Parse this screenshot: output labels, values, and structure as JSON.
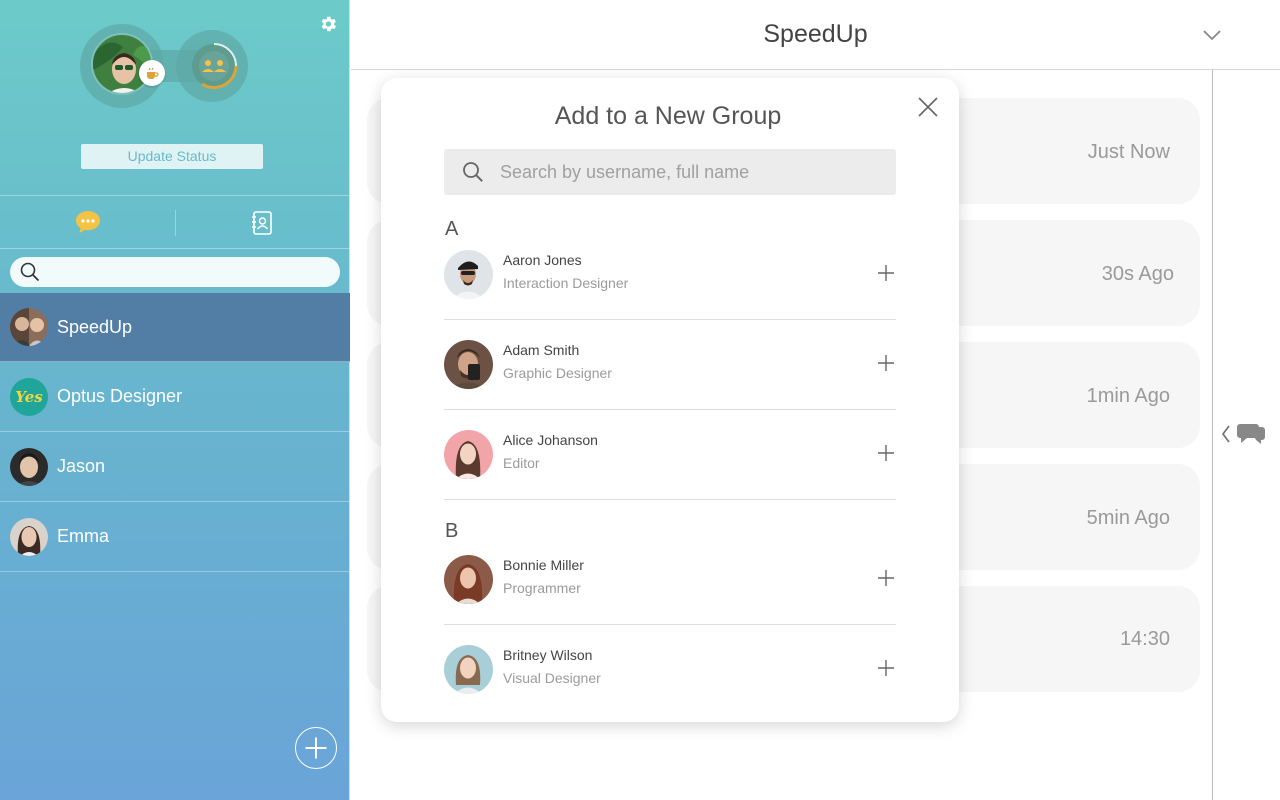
{
  "sidebar": {
    "update_status_label": "Update Status",
    "search_placeholder": "",
    "chats": [
      {
        "name": "SpeedUp",
        "active": true
      },
      {
        "name": "Optus Designer",
        "active": false,
        "avatar_text": "Yes"
      },
      {
        "name": "Jason",
        "active": false
      },
      {
        "name": "Emma",
        "active": false
      }
    ]
  },
  "main": {
    "title": "SpeedUp",
    "messages": [
      {
        "time": "Just Now"
      },
      {
        "time": "30s Ago"
      },
      {
        "time": "1min Ago"
      },
      {
        "time": "5min Ago"
      },
      {
        "time": "14:30"
      }
    ]
  },
  "modal": {
    "title": "Add to a New Group",
    "search_placeholder": "Search by username, full name",
    "sections": [
      {
        "letter": "A",
        "contacts": [
          {
            "name": "Aaron Jones",
            "role": "Interaction Designer"
          },
          {
            "name": "Adam Smith",
            "role": "Graphic Designer"
          },
          {
            "name": "Alice Johanson",
            "role": "Editor"
          }
        ]
      },
      {
        "letter": "B",
        "contacts": [
          {
            "name": "Bonnie Miller",
            "role": "Programmer"
          },
          {
            "name": "Britney Wilson",
            "role": "Visual Designer"
          }
        ]
      }
    ]
  },
  "colors": {
    "sidebar_top": "#6ccbc9",
    "sidebar_bottom": "#6aa4d8",
    "active_chat": "#527ea5",
    "chat_bubble_icon": "#f5c344"
  },
  "icons": [
    "gear-icon",
    "coffee-icon",
    "group-icon",
    "chat-bubble-icon",
    "contacts-icon",
    "search-icon",
    "plus-circle-icon",
    "chevron-down-icon",
    "close-icon",
    "plus-icon",
    "chevron-left-icon",
    "chat-bubbles-icon"
  ]
}
